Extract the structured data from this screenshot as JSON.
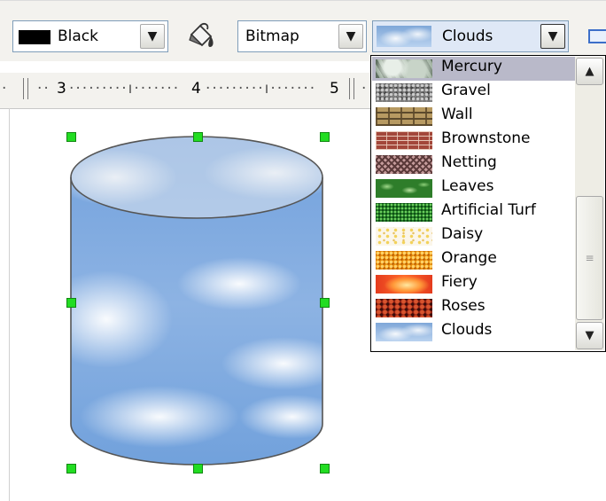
{
  "toolbar": {
    "line_color": {
      "label": "Black",
      "swatch": "#000000"
    },
    "area_style": "Bitmap",
    "bitmap": {
      "label": "Clouds"
    },
    "dropdown_glyph": "▼"
  },
  "ruler": {
    "numbers": [
      "3",
      "4",
      "5"
    ]
  },
  "bitmap_list": {
    "items": [
      {
        "label": "Mercury",
        "thumb": "mercury",
        "selected": true
      },
      {
        "label": "Gravel",
        "thumb": "gravel"
      },
      {
        "label": "Wall",
        "thumb": "wall"
      },
      {
        "label": "Brownstone",
        "thumb": "brownstone"
      },
      {
        "label": "Netting",
        "thumb": "netting"
      },
      {
        "label": "Leaves",
        "thumb": "leaves"
      },
      {
        "label": "Artificial Turf",
        "thumb": "turf"
      },
      {
        "label": "Daisy",
        "thumb": "daisy"
      },
      {
        "label": "Orange",
        "thumb": "orange"
      },
      {
        "label": "Fiery",
        "thumb": "fiery"
      },
      {
        "label": "Roses",
        "thumb": "roses"
      },
      {
        "label": "Clouds",
        "thumb": "clouds"
      }
    ],
    "scroll_up": "▲",
    "scroll_down": "▼",
    "grip": "≡"
  },
  "colors": {
    "selection_handle": "#22dd22",
    "list_highlight": "#b9b9c9",
    "shape_outline": "#555555"
  },
  "shape": {
    "type": "cylinder",
    "fill": "Clouds"
  }
}
